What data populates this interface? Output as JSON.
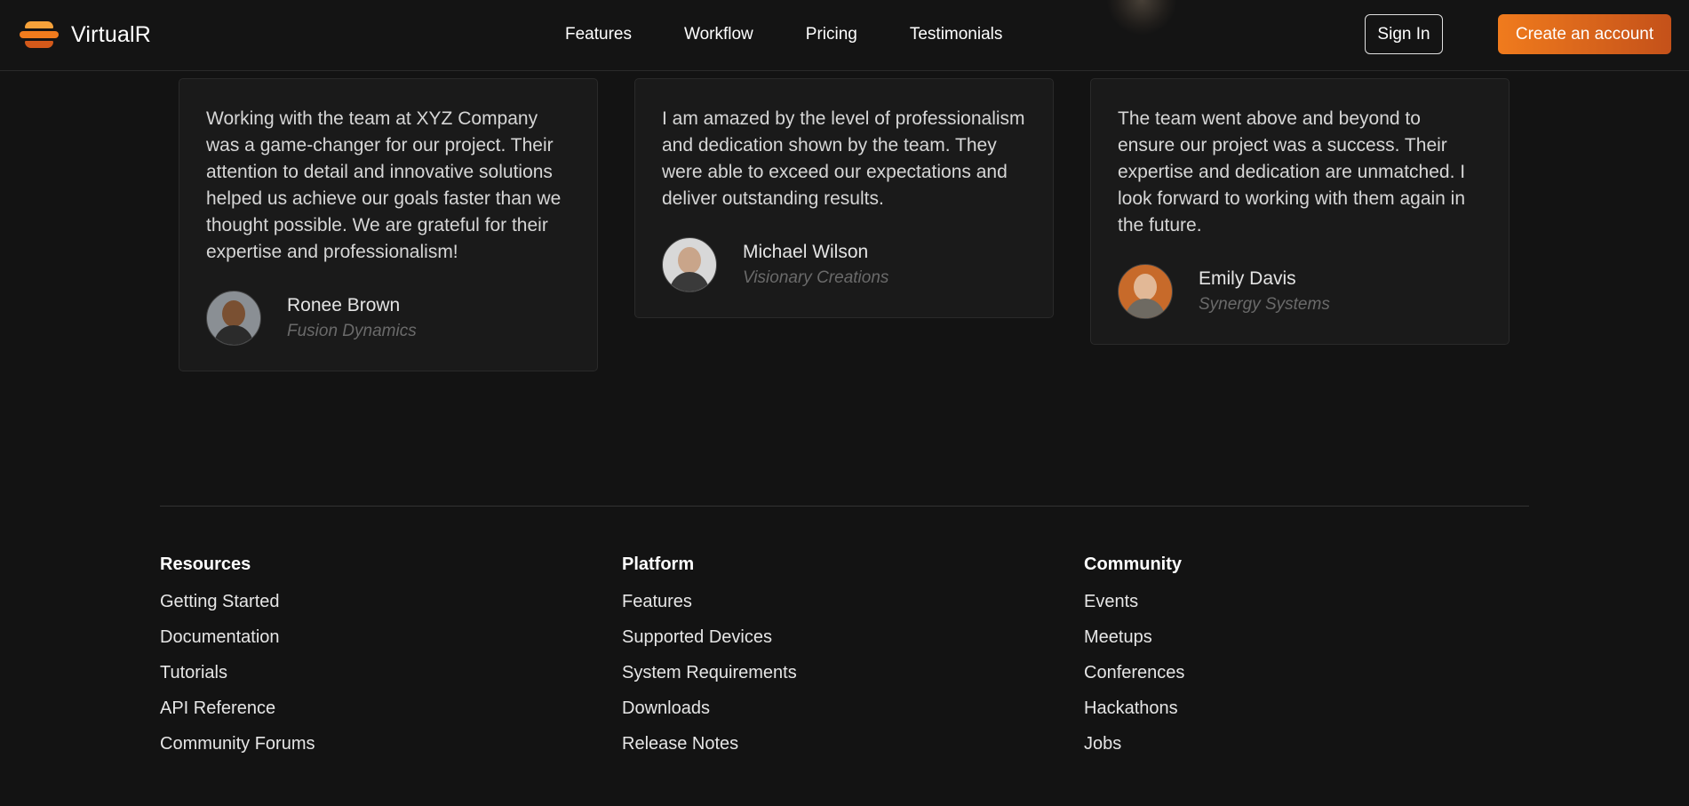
{
  "brand": {
    "name": "VirtualR",
    "logo_colors": [
      "#f7a23a",
      "#f07b1d",
      "#d4591a"
    ]
  },
  "nav": {
    "links": [
      "Features",
      "Workflow",
      "Pricing",
      "Testimonials"
    ],
    "sign_in": "Sign In",
    "create_account": "Create an account"
  },
  "accent": "#f07b1d",
  "testimonials": [
    {
      "quote": "Working with the team at XYZ Company was a game-changer for our project. Their attention to detail and innovative solutions helped us achieve our goals faster than we thought possible. We are grateful for their expertise and professionalism!",
      "name": "Ronee Brown",
      "company": "Fusion Dynamics"
    },
    {
      "quote": "I am amazed by the level of professionalism and dedication shown by the team. They were able to exceed our expectations and deliver outstanding results.",
      "name": "Michael Wilson",
      "company": "Visionary Creations"
    },
    {
      "quote": "The team went above and beyond to ensure our project was a success. Their expertise and dedication are unmatched. I look forward to working with them again in the future.",
      "name": "Emily Davis",
      "company": "Synergy Systems"
    }
  ],
  "footer": {
    "columns": [
      {
        "heading": "Resources",
        "links": [
          "Getting Started",
          "Documentation",
          "Tutorials",
          "API Reference",
          "Community Forums"
        ]
      },
      {
        "heading": "Platform",
        "links": [
          "Features",
          "Supported Devices",
          "System Requirements",
          "Downloads",
          "Release Notes"
        ]
      },
      {
        "heading": "Community",
        "links": [
          "Events",
          "Meetups",
          "Conferences",
          "Hackathons",
          "Jobs"
        ]
      }
    ]
  }
}
